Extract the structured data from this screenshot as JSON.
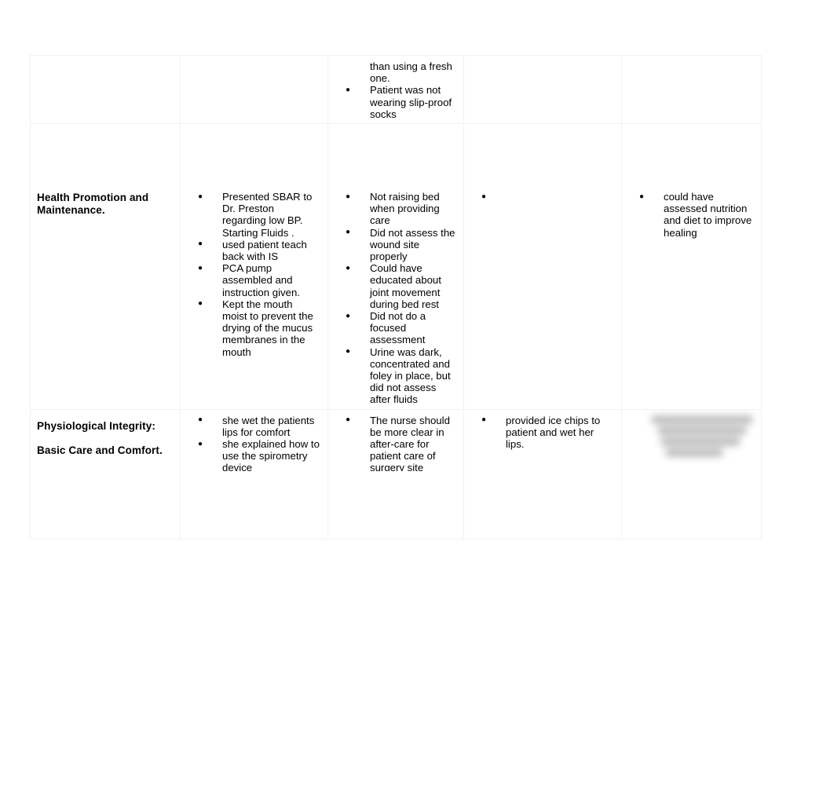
{
  "document": {
    "type": "clinical-evaluation-rubric-table",
    "column_count": 5,
    "row_count": 3
  },
  "table": {
    "rows": [
      {
        "id": "row-partial-top",
        "category": "",
        "cells": [
          {
            "name": "category-cell",
            "items": []
          },
          {
            "name": "strengths-cell",
            "items": []
          },
          {
            "name": "areas-for-improvement-cell",
            "continuation": "than using a fresh one.",
            "items": [
              "Patient was not wearing slip-proof socks"
            ]
          },
          {
            "name": "comments-cell",
            "items": []
          },
          {
            "name": "recommendations-cell",
            "items": []
          }
        ]
      },
      {
        "id": "row-health-promotion",
        "category": "Health Promotion and Maintenance.",
        "cells": [
          {
            "name": "category-cell",
            "items": []
          },
          {
            "name": "strengths-cell",
            "items": [
              "Presented SBAR to Dr. Preston regarding low BP. Starting Fluids .",
              "used patient teach back with IS",
              "PCA pump assembled and instruction given.",
              "Kept the mouth moist to prevent the drying of the mucus membranes in the mouth"
            ]
          },
          {
            "name": "areas-for-improvement-cell",
            "items": [
              "Not raising bed when providing care",
              "Did not assess the wound site properly",
              "Could have educated about joint movement during bed rest",
              "Did not do a focused assessment",
              "Urine was dark, concentrated and foley in place, but did not assess after fluids"
            ]
          },
          {
            "name": "comments-cell",
            "empty_bullet": true,
            "items": []
          },
          {
            "name": "recommendations-cell",
            "items": [
              "could have assessed nutrition and diet to improve healing"
            ]
          }
        ]
      },
      {
        "id": "row-physiological-integrity",
        "category_line_1": "Physiological Integrity:",
        "category_line_2": "Basic Care and Comfort.",
        "cells": [
          {
            "name": "category-cell",
            "items": []
          },
          {
            "name": "strengths-cell",
            "items": [
              "she wet the patients lips for comfort",
              "she explained how to use the spirometry device"
            ]
          },
          {
            "name": "areas-for-improvement-cell",
            "items": [
              "The nurse should be more clear in after-care for patient care of surgery site"
            ]
          },
          {
            "name": "comments-cell",
            "items": [
              "provided ice chips to patient and wet her lips."
            ]
          },
          {
            "name": "recommendations-cell",
            "redacted": true,
            "items": []
          }
        ]
      }
    ]
  },
  "colors": {
    "page_background": "#ffffff",
    "text": "#000000",
    "table_border": "#f2f2f2",
    "redacted_block": "#a6a6a6"
  }
}
